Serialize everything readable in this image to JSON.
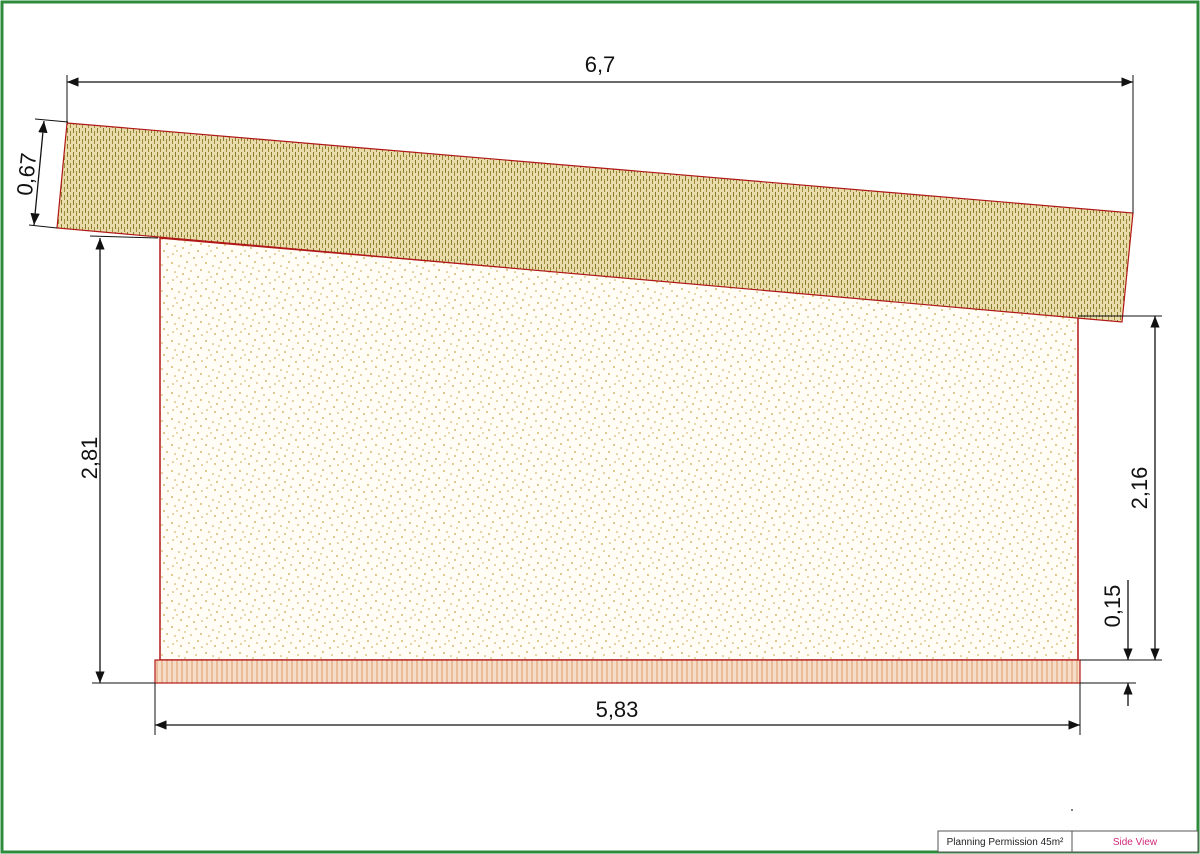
{
  "drawing": {
    "dimensions": {
      "roof_width": "6,7",
      "roof_thickness": "0,67",
      "front_height": "2,81",
      "back_height": "2,16",
      "base_height": "0,15",
      "base_width": "5,83"
    },
    "title_block": {
      "project": "Planning Permission 45m²",
      "view": "Side View"
    }
  },
  "colors": {
    "frame": "#2e8b3c",
    "outline": "#b01818",
    "dimension_line": "#111111",
    "roof_fill": "#e8dcaa",
    "roof_grain": "#8a7a2c",
    "wall_fill": "#fffdf6",
    "wall_speckle": "#c8a445",
    "base_fill": "#f6ddc8",
    "base_grain": "#e09a6a",
    "title_view_text": "#d0287a"
  }
}
